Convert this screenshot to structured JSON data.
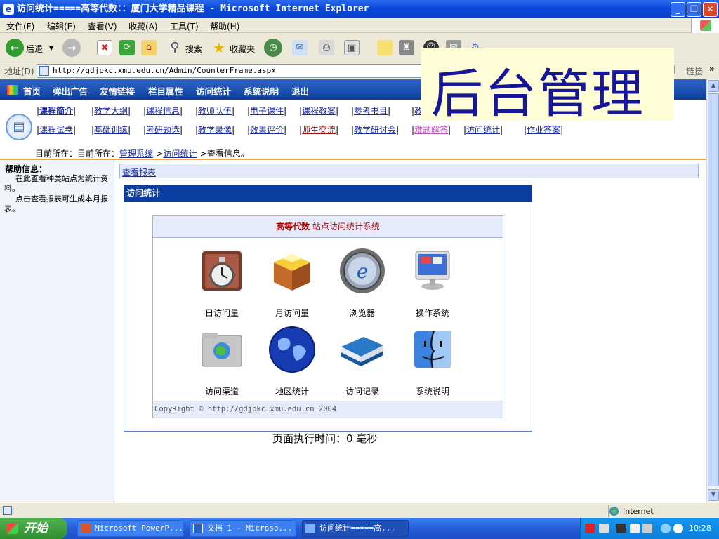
{
  "window": {
    "title": "访问统计=====高等代数：：厦门大学精品课程 - Microsoft Internet Explorer"
  },
  "menu": [
    "文件(F)",
    "编辑(E)",
    "查看(V)",
    "收藏(A)",
    "工具(T)",
    "帮助(H)"
  ],
  "toolbar": {
    "back_label": "后退",
    "search_label": "搜索",
    "favorites_label": "收藏夹"
  },
  "address": {
    "label": "地址(D)",
    "url": "http://gdjpkc.xmu.edu.cn/Admin/CounterFrame.aspx",
    "links_label": "链接"
  },
  "overlay": {
    "text": "后台管理"
  },
  "nav": [
    "首页",
    "弹出广告",
    "友情链接",
    "栏目属性",
    "访问统计",
    "系统说明",
    "退出"
  ],
  "links_row1": [
    "课程简介",
    "教学大纲",
    "课程信息",
    "教师队伍",
    "电子课件",
    "课程教案",
    "参考书目",
    "教"
  ],
  "links_row2": [
    "课程试卷",
    "基础训练",
    "考研题选",
    "教学录像",
    "效果评价",
    "师生交流",
    "教学研讨会",
    "难题解答",
    "访问统计",
    "作业答案"
  ],
  "breadcrumb": {
    "prefix": "目前所在：目前所在：",
    "item1": "管理系统",
    "sep": "->",
    "item2": "访问统计",
    "tail": "->查看信息。"
  },
  "help": {
    "title": "帮助信息：",
    "p1": "在此查看种类站点为统计资料。",
    "p2": "点击查看报表可生成本月报表。"
  },
  "report_link": "查看报表",
  "panel": {
    "title": "访问统计",
    "heading_bold": "高等代数",
    "heading_rest": "站点访问统计系统",
    "items": [
      "日访问量",
      "月访问量",
      "浏览器",
      "操作系统",
      "访问渠道",
      "地区统计",
      "访问记录",
      "系统说明"
    ],
    "copyright": "CopyRight © http://gdjpkc.xmu.edu.cn 2004"
  },
  "exec_time": "页面执行时间：0 毫秒",
  "status": {
    "zone": "Internet"
  },
  "taskbar": {
    "start": "开始",
    "tasks": [
      "Microsoft PowerP...",
      "文档 1 - Microso...",
      "访问统计=====高..."
    ],
    "clock": "10:28"
  },
  "colors": {
    "nav_blue": "#0d3e9c",
    "link_blue": "#1a2aa8",
    "heading_red": "#b00000",
    "overlay_text": "#16169a"
  }
}
